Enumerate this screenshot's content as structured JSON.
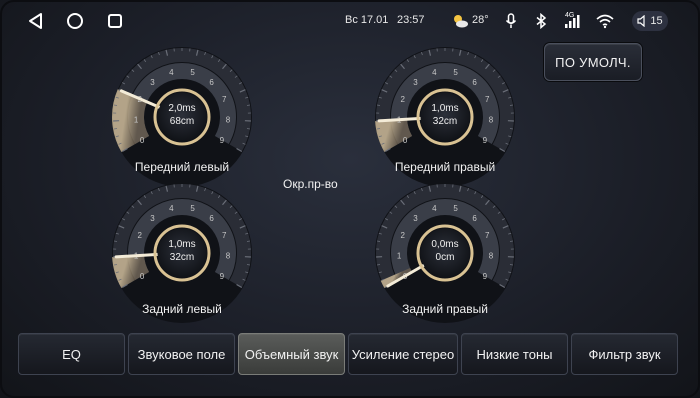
{
  "status": {
    "day_date": "Вс 17.01",
    "time": "23:57",
    "temperature": "28°",
    "network": "4G",
    "volume": "15"
  },
  "icons": {
    "back": "back-triangle-icon",
    "home": "home-circle-icon",
    "recents": "recents-square-icon",
    "weather": "partly-cloudy-icon",
    "mic": "microphone-icon",
    "bluetooth": "bluetooth-icon",
    "signal": "cell-signal-icon",
    "wifi": "wifi-icon",
    "volume": "speaker-icon"
  },
  "default_button": "ПО УМОЛЧ.",
  "center_label": "Окр.пр-во",
  "dials": [
    {
      "id": "front-left",
      "label": "Передний левый",
      "time": "2,0ms",
      "dist": "68cm",
      "level": 2
    },
    {
      "id": "front-right",
      "label": "Передний правый",
      "time": "1,0ms",
      "dist": "32cm",
      "level": 1
    },
    {
      "id": "rear-left",
      "label": "Задний левый",
      "time": "1,0ms",
      "dist": "32cm",
      "level": 1
    },
    {
      "id": "rear-right",
      "label": "Задний правый",
      "time": "0,0ms",
      "dist": "0cm",
      "level": 0
    }
  ],
  "tabs": [
    "EQ",
    "Звуковое поле",
    "Объемный звук",
    "Усиление стерео",
    "Низкие тоны",
    "Фильтр звук"
  ],
  "active_tab": 2,
  "colors": {
    "accent_gold": "#e0c9a0",
    "active_tab": "#4a4c4a"
  }
}
